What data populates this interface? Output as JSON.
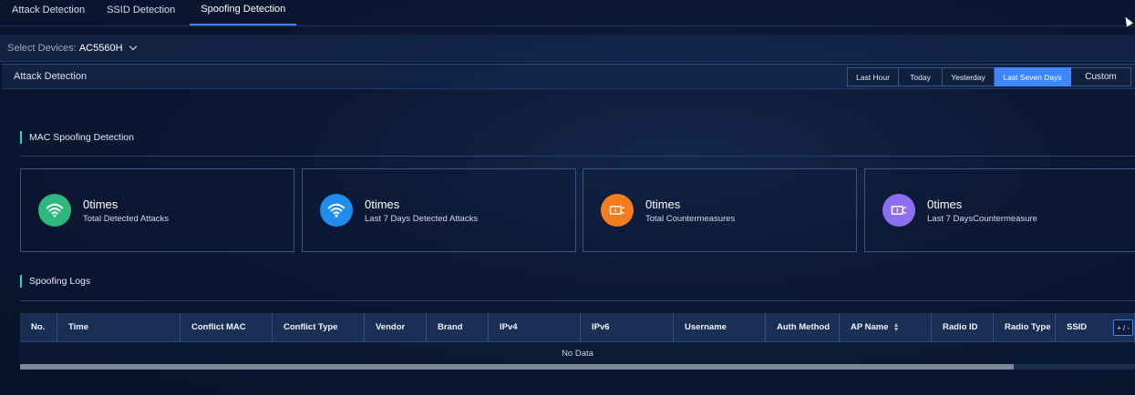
{
  "tabs": [
    {
      "label": "Attack Detection",
      "active": false
    },
    {
      "label": "SSID Detection",
      "active": false
    },
    {
      "label": "Spoofing Detection",
      "active": true
    }
  ],
  "device_select": {
    "label": "Select Devices:",
    "value": "AC5560H"
  },
  "header": {
    "title": "Attack Detection",
    "ranges": [
      "Last Hour",
      "Today",
      "Yesterday",
      "Last Seven Days",
      "Custom"
    ],
    "active_range": "Last Seven Days"
  },
  "mac_section": {
    "title": "MAC Spoofing Detection"
  },
  "cards": [
    {
      "value": "0times",
      "label": "Total Detected Attacks",
      "icon": "wifi-icon",
      "color": "#2fb87e"
    },
    {
      "value": "0times",
      "label": "Last 7 Days Detected Attacks",
      "icon": "wifi-icon",
      "color": "#1f8cf0"
    },
    {
      "value": "0times",
      "label": "Total Countermeasures",
      "icon": "countermeasure-icon",
      "color": "#f47c1c"
    },
    {
      "value": "0times",
      "label": "Last 7 DaysCountermeasure",
      "icon": "countermeasure-icon",
      "color": "#8b6ff0"
    }
  ],
  "logs_section": {
    "title": "Spoofing Logs"
  },
  "table": {
    "columns": [
      "No.",
      "Time",
      "Conflict MAC",
      "Conflict Type",
      "Vendor",
      "Brand",
      "IPv4",
      "IPv6",
      "Username",
      "Auth Method",
      "AP Name",
      "Radio ID",
      "Radio Type",
      "SSID"
    ],
    "sortable_column": "AP Name",
    "column_toggle": "+ / -",
    "empty_text": "No Data"
  }
}
